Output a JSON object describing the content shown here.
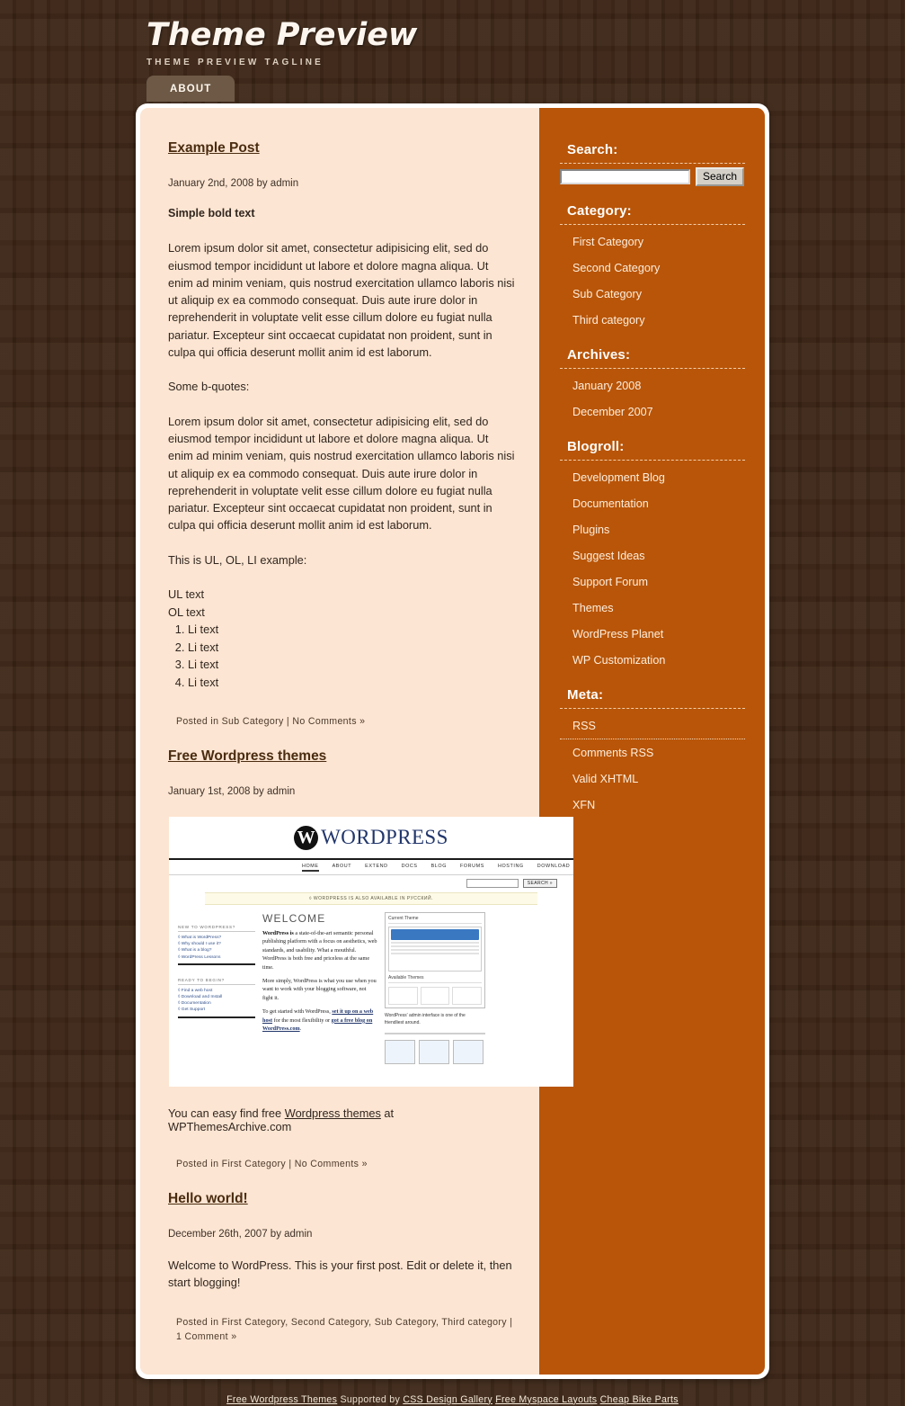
{
  "header": {
    "title": "Theme Preview",
    "tagline": "THEME PREVIEW TAGLINE"
  },
  "nav": {
    "tabs": [
      {
        "label": "ABOUT"
      }
    ]
  },
  "posts": [
    {
      "title": "Example Post",
      "date": "January 2nd, 2008 by admin",
      "bold_line": "Simple bold text",
      "paragraph1": "Lorem ipsum dolor sit amet, consectetur adipisicing elit, sed do eiusmod tempor incididunt ut labore et dolore magna aliqua. Ut enim ad minim veniam, quis nostrud exercitation ullamco laboris nisi ut aliquip ex ea commodo consequat. Duis aute irure dolor in reprehenderit in voluptate velit esse cillum dolore eu fugiat nulla pariatur. Excepteur sint occaecat cupidatat non proident, sunt in culpa qui officia deserunt mollit anim id est laborum.",
      "bquote_intro": "Some b-quotes:",
      "paragraph2": "Lorem ipsum dolor sit amet, consectetur adipisicing elit, sed do eiusmod tempor incididunt ut labore et dolore magna aliqua. Ut enim ad minim veniam, quis nostrud exercitation ullamco laboris nisi ut aliquip ex ea commodo consequat. Duis aute irure dolor in reprehenderit in voluptate velit esse cillum dolore eu fugiat nulla pariatur. Excepteur sint occaecat cupidatat non proident, sunt in culpa qui officia deserunt mollit anim id est laborum.",
      "list_intro": "This is UL, OL, LI example:",
      "ul_item": "UL text",
      "ol_item": "OL text",
      "li_items": [
        "Li text",
        "Li text",
        "Li text",
        "Li text"
      ],
      "meta_prefix": "Posted in",
      "meta_categories": "Sub Category",
      "meta_separator": "|",
      "meta_comments": "No Comments »"
    },
    {
      "title": "Free Wordpress themes",
      "date": "January 1st, 2008 by admin",
      "note_before_link": "You can easy find free ",
      "note_link": "Wordpress themes",
      "note_after_link": " at WPThemesArchive.com",
      "meta_prefix": "Posted in",
      "meta_categories": "First Category",
      "meta_separator": "|",
      "meta_comments": "No Comments »"
    },
    {
      "title": "Hello world!",
      "date": "December 26th, 2007 by admin",
      "paragraph1": "Welcome to WordPress. This is your first post. Edit or delete it, then start blogging!",
      "meta_prefix": "Posted in",
      "meta_categories": "First Category, Second Category, Sub Category, Third category",
      "meta_separator": "|",
      "meta_comments": "1 Comment »"
    }
  ],
  "wp_screenshot": {
    "wordmark": "WORDPRESS",
    "logo_letter": "W",
    "nav": [
      "HOME",
      "ABOUT",
      "EXTEND",
      "DOCS",
      "BLOG",
      "FORUMS",
      "HOSTING",
      "DOWNLOAD"
    ],
    "search_button": "SEARCH »",
    "notice": "◊ WORDPRESS IS ALSO AVAILABLE IN РУССКИЙ.",
    "welcome_heading": "WELCOME",
    "left_head_1": "NEW TO WORDPRESS?",
    "left_links_1": [
      "◊ What is WordPress?",
      "◊ Why should I use it?",
      "◊ What is a blog?",
      "◊ WordPress Lessons"
    ],
    "left_head_2": "READY TO BEGIN?",
    "left_links_2": [
      "◊ Find a web host",
      "◊ Download and Install",
      "◊ Documentation",
      "◊ Get Support"
    ],
    "para_1_bold": "WordPress is",
    "para_1": " a state-of-the-art semantic personal publishing platform with a focus on aesthetics, web standards, and usability. What a mouthful. WordPress is both free and priceless at the same time.",
    "para_2": "More simply, WordPress is what you use when you want to work with your blogging software, not fight it.",
    "para_3_pre": "To get started with WordPress, ",
    "para_3_link_1": "set it up on a web host",
    "para_3_mid": " for the most flexibility or ",
    "para_3_link_2": "got a free blog on WordPress.com",
    "para_3_end": ".",
    "panel_title_current": "Current Theme",
    "panel_title_available": "Available Themes",
    "panel_caption": "WordPress' admin interface is one of the friendliest around."
  },
  "sidebar": {
    "blocks": [
      {
        "heading": "Search:",
        "type": "search",
        "search_value": "",
        "search_placeholder": "",
        "search_button": "Search"
      },
      {
        "heading": "Category:",
        "type": "links",
        "items": [
          "First Category",
          "Second Category",
          "Sub Category",
          "Third category"
        ]
      },
      {
        "heading": "Archives:",
        "type": "links",
        "items": [
          "January 2008",
          "December 2007"
        ]
      },
      {
        "heading": "Blogroll:",
        "type": "links",
        "items": [
          "Development Blog",
          "Documentation",
          "Plugins",
          "Suggest Ideas",
          "Support Forum",
          "Themes",
          "WordPress Planet",
          "WP Customization"
        ]
      },
      {
        "heading": "Meta:",
        "type": "links",
        "items": [
          "RSS",
          "Comments RSS",
          "Valid XHTML",
          "XFN"
        ]
      }
    ]
  },
  "footer": {
    "link_1": "Free Wordpress Themes",
    "text_1": " Supported by ",
    "link_2": "CSS Design Gallery",
    "text_2": " ",
    "link_3": "Free Myspace Layouts",
    "text_3": " ",
    "link_4": "Cheap Bike Parts"
  },
  "colors": {
    "background": "#3b2415",
    "sidebar": "#b95508",
    "content": "#fce5d2",
    "tab": "#6d5946",
    "heading_text": "#4a2c10"
  }
}
